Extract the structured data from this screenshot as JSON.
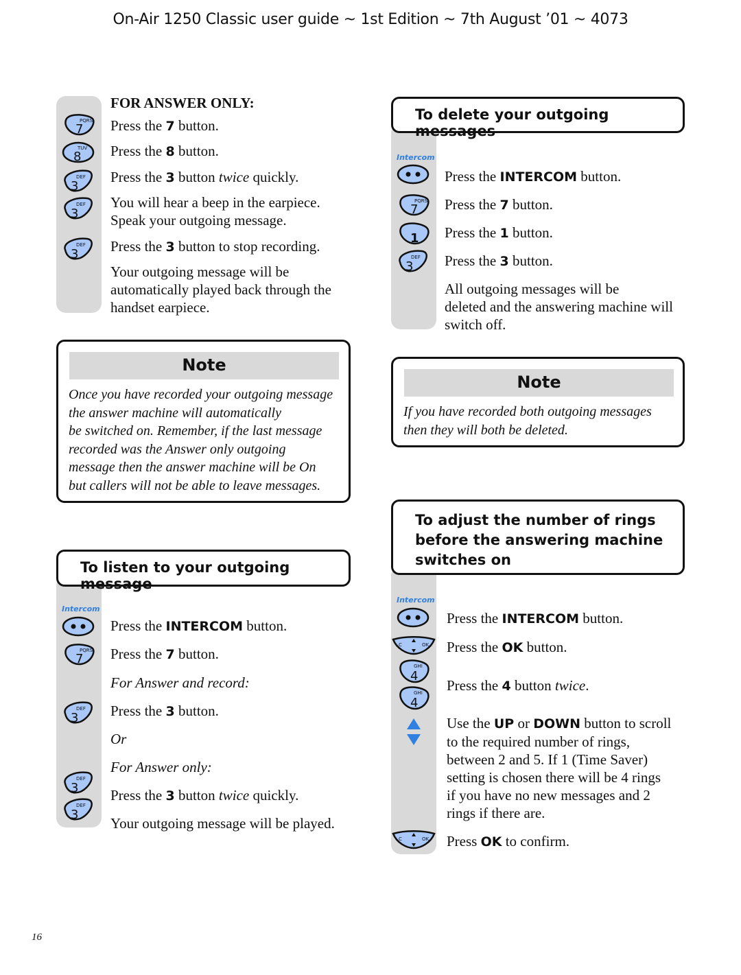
{
  "header": {
    "title": "On-Air 1250 Classic user guide ~ 1st Edition ~ 7th August ’01 ~ 4073"
  },
  "page_number": "16",
  "colors": {
    "key_fill": "#a9c8f7",
    "rail_gray": "#d9d9d9",
    "intercom_blue": "#2f80e0",
    "arrow_blue": "#2f80e0"
  },
  "icons": {
    "key": "phone-keypad-key",
    "intercom": "intercom-button",
    "nav": "navigation-ok-button",
    "up": "up-arrow",
    "down": "down-arrow"
  },
  "answer_only": {
    "heading": "FOR ANSWER ONLY:",
    "steps": [
      {
        "key": "7",
        "letters": "PQRS",
        "pre": "Press the ",
        "bold": "7",
        "post": " button."
      },
      {
        "key": "8",
        "letters": "TUV",
        "pre": "Press the ",
        "bold": "8",
        "post": " button."
      },
      {
        "key": "3",
        "letters": "DEF",
        "pre": "Press the ",
        "bold": "3",
        "post": " button ",
        "italic": "twice",
        "post2": " quickly."
      },
      {
        "key": "3",
        "letters": "DEF",
        "line1": "You will hear a beep in the earpiece.",
        "line2": "Speak your outgoing message."
      },
      {
        "key": "3",
        "letters": "DEF",
        "pre": "Press the ",
        "bold": "3",
        "post": " button to stop recording."
      }
    ],
    "result": [
      "Your outgoing message will be",
      "automatically played back through the",
      "handset earpiece."
    ]
  },
  "note_left": {
    "title": "Note",
    "lines": [
      "Once you have recorded your outgoing message",
      "the answer machine will automatically",
      "be switched on. Remember, if the last message",
      "recorded was the Answer only outgoing",
      "message then the answer machine will be On",
      "but callers will not be able to leave messages."
    ]
  },
  "listen": {
    "title": "To listen to your outgoing message",
    "intercom_label": "Intercom",
    "steps": [
      {
        "pre": "Press the ",
        "bold": "INTERCOM",
        "post": " button."
      },
      {
        "pre": "Press the ",
        "bold": "7",
        "post": " button."
      },
      {
        "italic_line": "For Answer and record:"
      },
      {
        "pre": "Press the ",
        "bold": "3",
        "post": " button."
      },
      {
        "italic_line": "Or"
      },
      {
        "italic_line": "For Answer only:"
      },
      {
        "pre": "Press the ",
        "bold": "3",
        "post": " button ",
        "italic": "twice",
        "post2": " quickly."
      },
      {
        "plain": "Your outgoing message will be played."
      }
    ],
    "keys": [
      {
        "key": "7",
        "letters": "PQRS"
      },
      {
        "key": "3",
        "letters": "DEF"
      },
      {
        "key": "3",
        "letters": "DEF"
      },
      {
        "key": "3",
        "letters": "DEF"
      }
    ]
  },
  "delete": {
    "title": "To delete your outgoing messages",
    "intercom_label": "Intercom",
    "steps": [
      {
        "pre": "Press the ",
        "bold": "INTERCOM",
        "post": " button."
      },
      {
        "key": "7",
        "letters": "PQRS",
        "pre": "Press the ",
        "bold": "7",
        "post": " button."
      },
      {
        "key": "1",
        "letters": "",
        "pre": "Press the ",
        "bold": "1",
        "post": " button."
      },
      {
        "key": "3",
        "letters": "DEF",
        "pre": "Press the ",
        "bold": "3",
        "post": " button."
      }
    ],
    "result": [
      "All outgoing messages will be",
      "deleted and the answering machine will",
      "switch off."
    ]
  },
  "note_right": {
    "title": "Note",
    "lines": [
      "If you have recorded both outgoing messages",
      "then they will both be deleted."
    ]
  },
  "rings": {
    "title_lines": [
      "To adjust the number of rings",
      "before the answering machine",
      "switches on"
    ],
    "intercom_label": "Intercom",
    "nav_c": "C",
    "nav_ok": "OK",
    "keys": [
      {
        "key": "4",
        "letters": "GHI"
      },
      {
        "key": "4",
        "letters": "GHI"
      }
    ],
    "steps": [
      {
        "pre": "Press the ",
        "bold": "INTERCOM",
        "post": " button."
      },
      {
        "pre": "Press the ",
        "bold": "OK",
        "post": " button."
      },
      {
        "pre": "Press the ",
        "bold": "4",
        "post": " button ",
        "italic": "twice",
        "post2": "."
      }
    ],
    "scroll": {
      "pre": "Use the ",
      "b1": "UP",
      "mid": " or ",
      "b2": "DOWN",
      "post": " button to scroll",
      "lines": [
        "to the required number of rings,",
        "between 2 and 5. If 1 (Time Saver)",
        "setting is chosen there will be 4 rings",
        "if you have no new messages and 2",
        "rings if there are."
      ]
    },
    "confirm": {
      "pre": "Press ",
      "bold": "OK",
      "post": " to confirm."
    }
  }
}
